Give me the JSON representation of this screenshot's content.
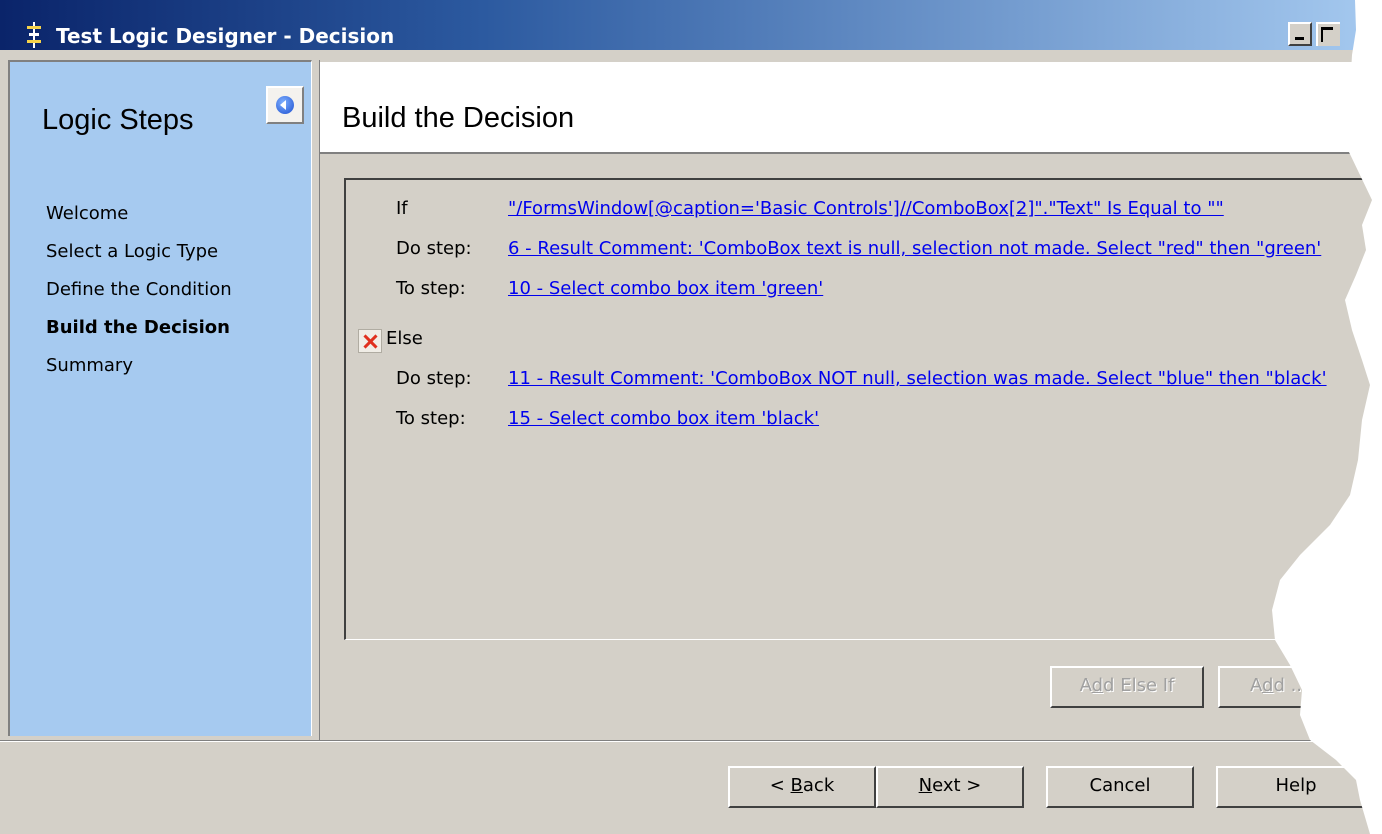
{
  "window": {
    "title": "Test Logic Designer - Decision"
  },
  "sidebar": {
    "title": "Logic Steps",
    "steps": [
      {
        "label": "Welcome"
      },
      {
        "label": "Select a Logic Type"
      },
      {
        "label": "Define the Condition"
      },
      {
        "label": "Build the Decision",
        "active": true
      },
      {
        "label": "Summary"
      }
    ]
  },
  "page": {
    "title": "Build the Decision"
  },
  "decision": {
    "if_label": "If",
    "if_value": "\"/FormsWindow[@caption='Basic Controls']//ComboBox[2]\".\"Text\" Is Equal to \"\"",
    "do_label": "Do step:",
    "do_value": "6 - Result Comment: 'ComboBox text is null, selection not made. Select \"red\" then \"green'",
    "to_label": "To step:",
    "to_value": "10 - Select combo box item 'green'",
    "else_label": "Else",
    "else_do_label": "Do step:",
    "else_do_value": "11 - Result Comment: 'ComboBox NOT null, selection was made. Select \"blue\" then \"black'",
    "else_to_label": "To step:",
    "else_to_value": "15 - Select combo box item 'black'"
  },
  "actions": {
    "add_else_if": {
      "pre": "A",
      "key": "d",
      "post": "d Else If"
    },
    "add_else": {
      "pre": "A",
      "key": "d",
      "post": "d ..."
    }
  },
  "footer": {
    "back": {
      "pre": "< ",
      "key": "B",
      "post": "ack"
    },
    "next": {
      "pre": "",
      "key": "N",
      "post": "ext >"
    },
    "cancel": "Cancel",
    "help": "Help"
  },
  "icons": [
    "app-icon",
    "collapse-arrow-icon",
    "delete-x-icon",
    "minimize-icon",
    "maximize-icon"
  ]
}
